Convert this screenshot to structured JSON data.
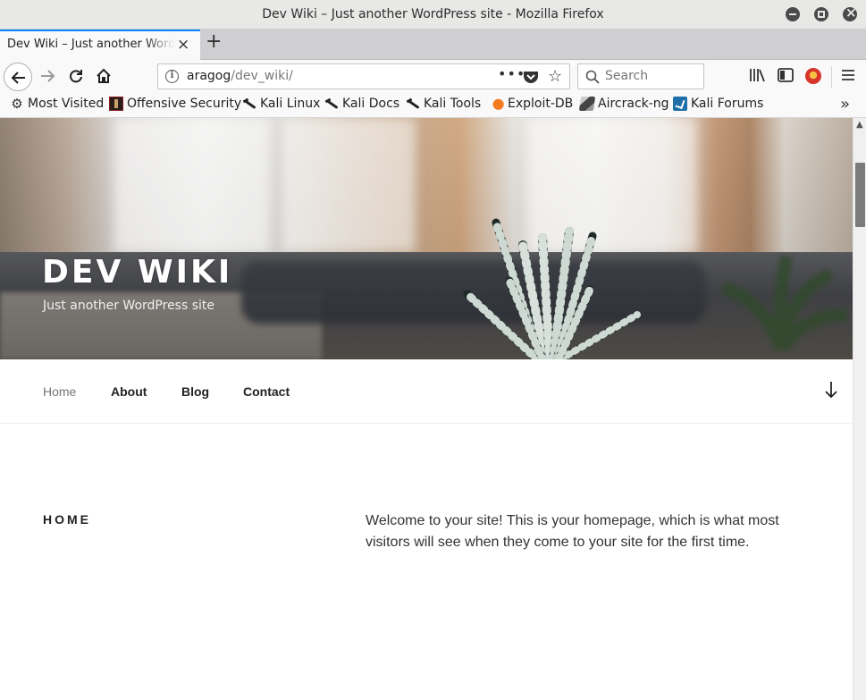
{
  "window": {
    "title": "Dev Wiki – Just another WordPress site - Mozilla Firefox"
  },
  "tab": {
    "title": "Dev Wiki – Just another WordPress site"
  },
  "urlbar": {
    "host": "aragog",
    "path": "/dev_wiki/"
  },
  "searchbar": {
    "placeholder": "Search"
  },
  "bookmarks": [
    {
      "label": "Most Visited",
      "icon": "gear-icon"
    },
    {
      "label": "Offensive Security",
      "icon": "offsec-icon"
    },
    {
      "label": "Kali Linux",
      "icon": "kali-icon"
    },
    {
      "label": "Kali Docs",
      "icon": "kali-icon"
    },
    {
      "label": "Kali Tools",
      "icon": "kali-icon"
    },
    {
      "label": "Exploit-DB",
      "icon": "exploit-db-icon"
    },
    {
      "label": "Aircrack-ng",
      "icon": "aircrack-icon"
    },
    {
      "label": "Kali Forums",
      "icon": "kali-forums-icon"
    }
  ],
  "site": {
    "title": "DEV WIKI",
    "tagline": "Just another WordPress site"
  },
  "nav": {
    "home": "Home",
    "about": "About",
    "blog": "Blog",
    "contact": "Contact"
  },
  "page": {
    "heading": "HOME",
    "content": "Welcome to your site! This is your homepage, which is what most visitors will see when they come to your site for the first time."
  },
  "colors": {
    "tab_accent": "#0a84ff",
    "nav_active": "#767676",
    "text": "#222222"
  }
}
